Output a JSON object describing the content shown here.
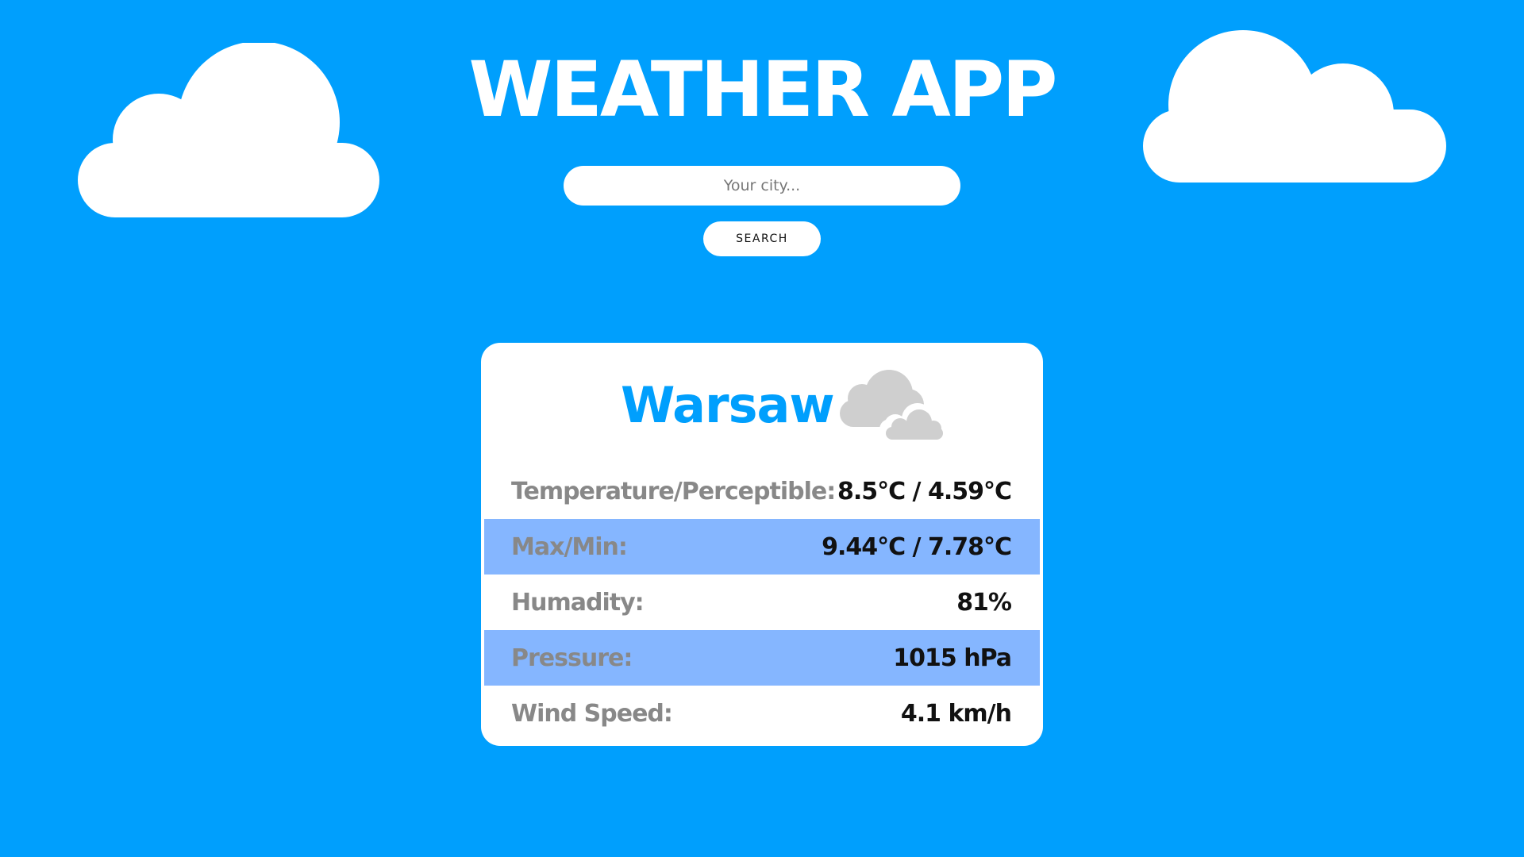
{
  "app": {
    "title": "WEATHER APP"
  },
  "search": {
    "placeholder": "Your city...",
    "value": "",
    "button_label": "SEARCH"
  },
  "weather": {
    "city": "Warsaw",
    "icon": "cloudy-icon",
    "rows": [
      {
        "label": "Temperature/Perceptible:",
        "value": "8.5°C / 4.59°C"
      },
      {
        "label": "Max/Min:",
        "value": "9.44°C / 7.78°C"
      },
      {
        "label": "Humadity:",
        "value": "81%"
      },
      {
        "label": "Pressure:",
        "value": "1015 hPa"
      },
      {
        "label": "Wind Speed:",
        "value": "4.1 km/h"
      }
    ]
  },
  "colors": {
    "background": "#009ffd",
    "accent": "#009ffd",
    "row_highlight": "#85b6ff",
    "label": "#888888",
    "value": "#111111",
    "card": "#ffffff"
  }
}
